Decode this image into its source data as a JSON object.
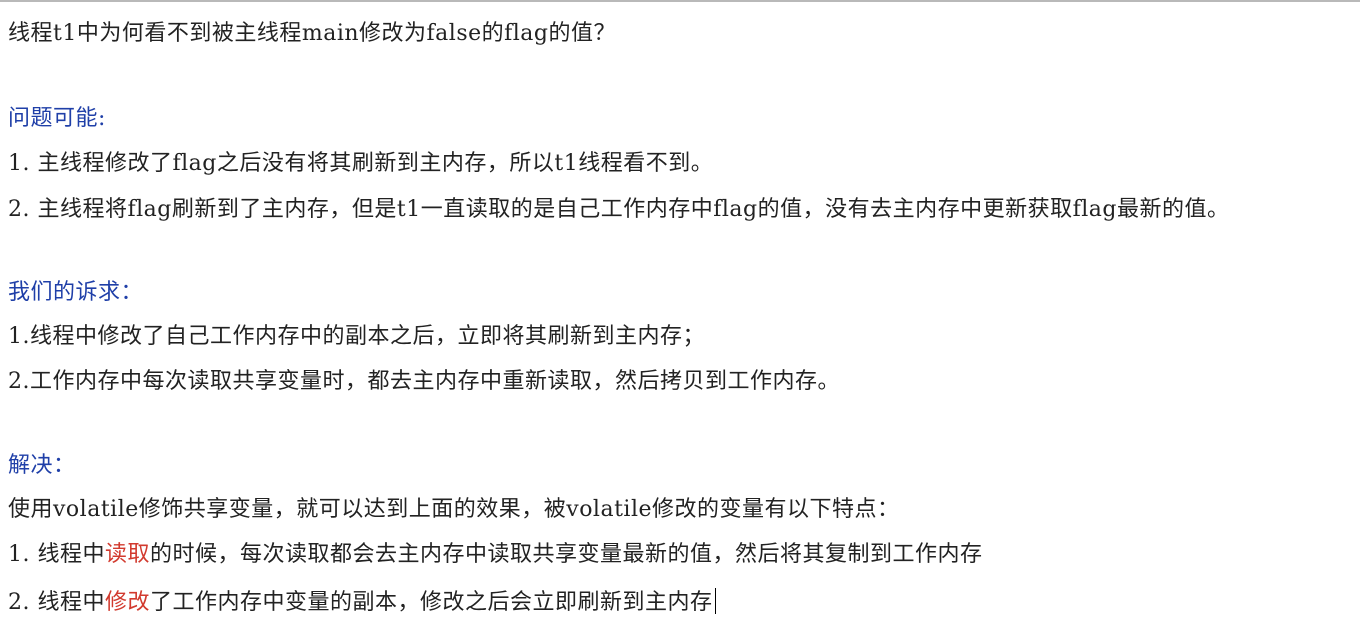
{
  "document": {
    "question": "线程t1中为何看不到被主线程main修改为false的flag的值？",
    "problem": {
      "heading": "问题可能:",
      "items": [
        "1. 主线程修改了flag之后没有将其刷新到主内存，所以t1线程看不到。",
        "2. 主线程将flag刷新到了主内存，但是t1一直读取的是自己工作内存中flag的值，没有去主内存中更新获取flag最新的值。"
      ]
    },
    "demand": {
      "heading": "我们的诉求：",
      "items": [
        "1.线程中修改了自己工作内存中的副本之后，立即将其刷新到主内存；",
        "2.工作内存中每次读取共享变量时，都去主内存中重新读取，然后拷贝到工作内存。"
      ]
    },
    "solution": {
      "heading": "解决：",
      "intro": "使用volatile修饰共享变量，就可以达到上面的效果，被volatile修改的变量有以下特点：",
      "item1": {
        "before": "1. 线程中",
        "highlight": "读取",
        "after": "的时候，每次读取都会去主内存中读取共享变量最新的值，然后将其复制到工作内存"
      },
      "item2": {
        "before": "2. 线程中",
        "highlight": "修改",
        "after": "了工作内存中变量的副本，修改之后会立即刷新到主内存"
      }
    },
    "colors": {
      "heading": "#1f3fa8",
      "highlight": "#d23a2e",
      "text": "#222222"
    }
  }
}
